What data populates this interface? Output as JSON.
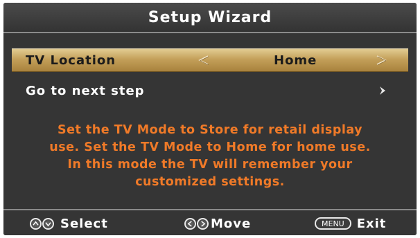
{
  "title": "Setup Wizard",
  "menu": {
    "tv_location_label": "TV Location",
    "tv_location_value": "Home",
    "next_step_label": "Go to next step"
  },
  "info_lines": [
    "Set the TV Mode to Store for retail display",
    "use. Set the TV Mode to Home for home use.",
    "In this mode the TV will remember your",
    "customized settings."
  ],
  "footer": {
    "select_label": "Select",
    "move_label": "Move",
    "menu_key": "MENU",
    "exit_label": "Exit"
  },
  "colors": {
    "panel_bg": "#353535",
    "highlight_gold": "#c4a05a",
    "info_text": "#f07a28"
  },
  "icons": [
    "left-arrow-icon",
    "right-arrow-icon",
    "chevron-right-icon",
    "up-button-icon",
    "down-button-icon",
    "left-button-icon",
    "right-button-icon"
  ]
}
